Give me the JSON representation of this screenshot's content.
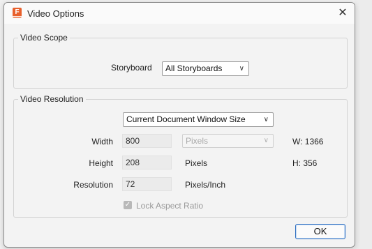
{
  "dialog": {
    "title": "Video Options",
    "close_symbol": "✕"
  },
  "video_scope": {
    "legend": "Video Scope",
    "storyboard_label": "Storyboard",
    "storyboard_value": "All Storyboards"
  },
  "video_resolution": {
    "legend": "Video Resolution",
    "size_mode_value": "Current Document Window Size",
    "width_label": "Width",
    "width_value": "800",
    "unit_value": "Pixels",
    "w_readout": "W: 1366",
    "height_label": "Height",
    "height_value": "208",
    "height_unit": "Pixels",
    "h_readout": "H: 356",
    "resolution_label": "Resolution",
    "resolution_value": "72",
    "resolution_unit": "Pixels/Inch",
    "lock_label": "Lock Aspect Ratio",
    "lock_checked": true
  },
  "buttons": {
    "ok_label": "OK"
  },
  "colors": {
    "accent": "#2f6fc1",
    "app_icon": "#e8602c"
  }
}
